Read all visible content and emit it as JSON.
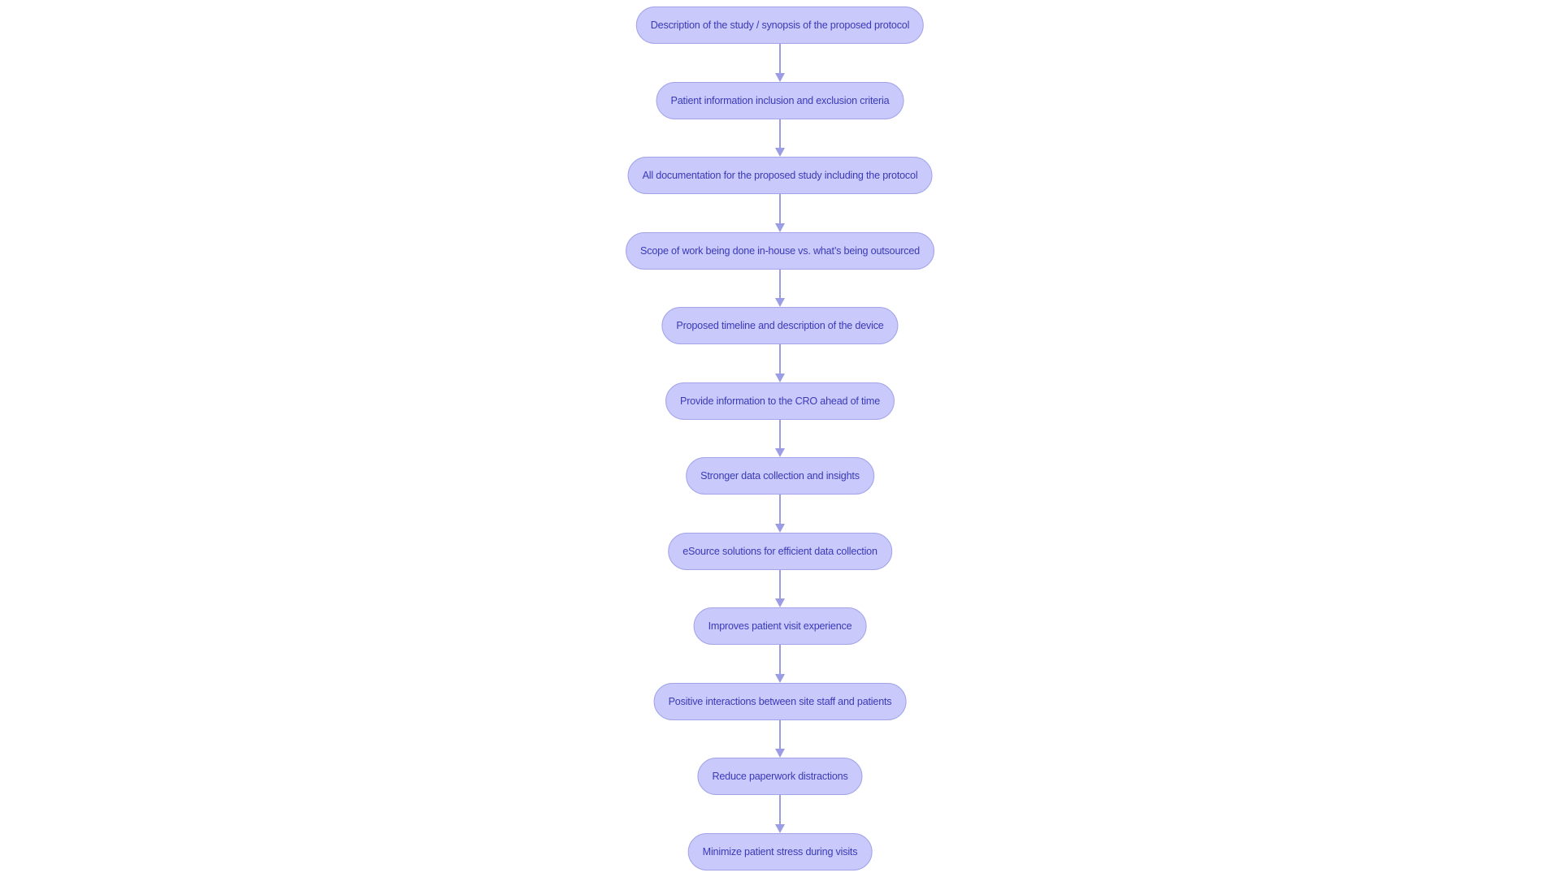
{
  "diagram": {
    "type": "flowchart",
    "direction": "top-to-bottom",
    "colors": {
      "node_fill": "#c9c9fb",
      "node_border": "#a3a3ea",
      "node_text": "#3a3ab8",
      "edge": "#9c9ce6",
      "background": "#ffffff"
    },
    "nodes": [
      {
        "id": "n1",
        "label": "Description of the study / synopsis of the proposed protocol"
      },
      {
        "id": "n2",
        "label": "Patient information inclusion and exclusion criteria"
      },
      {
        "id": "n3",
        "label": "All documentation for the proposed study including the protocol"
      },
      {
        "id": "n4",
        "label": "Scope of work being done in-house vs. what’s being outsourced"
      },
      {
        "id": "n5",
        "label": "Proposed timeline and description of the device"
      },
      {
        "id": "n6",
        "label": "Provide information to the CRO ahead of time"
      },
      {
        "id": "n7",
        "label": "Stronger data collection and insights"
      },
      {
        "id": "n8",
        "label": "eSource solutions for efficient data collection"
      },
      {
        "id": "n9",
        "label": "Improves patient visit experience"
      },
      {
        "id": "n10",
        "label": "Positive interactions between site staff and patients"
      },
      {
        "id": "n11",
        "label": "Reduce paperwork distractions"
      },
      {
        "id": "n12",
        "label": "Minimize patient stress during visits"
      }
    ],
    "edges": [
      {
        "from": "n1",
        "to": "n2"
      },
      {
        "from": "n2",
        "to": "n3"
      },
      {
        "from": "n3",
        "to": "n4"
      },
      {
        "from": "n4",
        "to": "n5"
      },
      {
        "from": "n5",
        "to": "n6"
      },
      {
        "from": "n6",
        "to": "n7"
      },
      {
        "from": "n7",
        "to": "n8"
      },
      {
        "from": "n8",
        "to": "n9"
      },
      {
        "from": "n9",
        "to": "n10"
      },
      {
        "from": "n10",
        "to": "n11"
      },
      {
        "from": "n11",
        "to": "n12"
      }
    ]
  }
}
